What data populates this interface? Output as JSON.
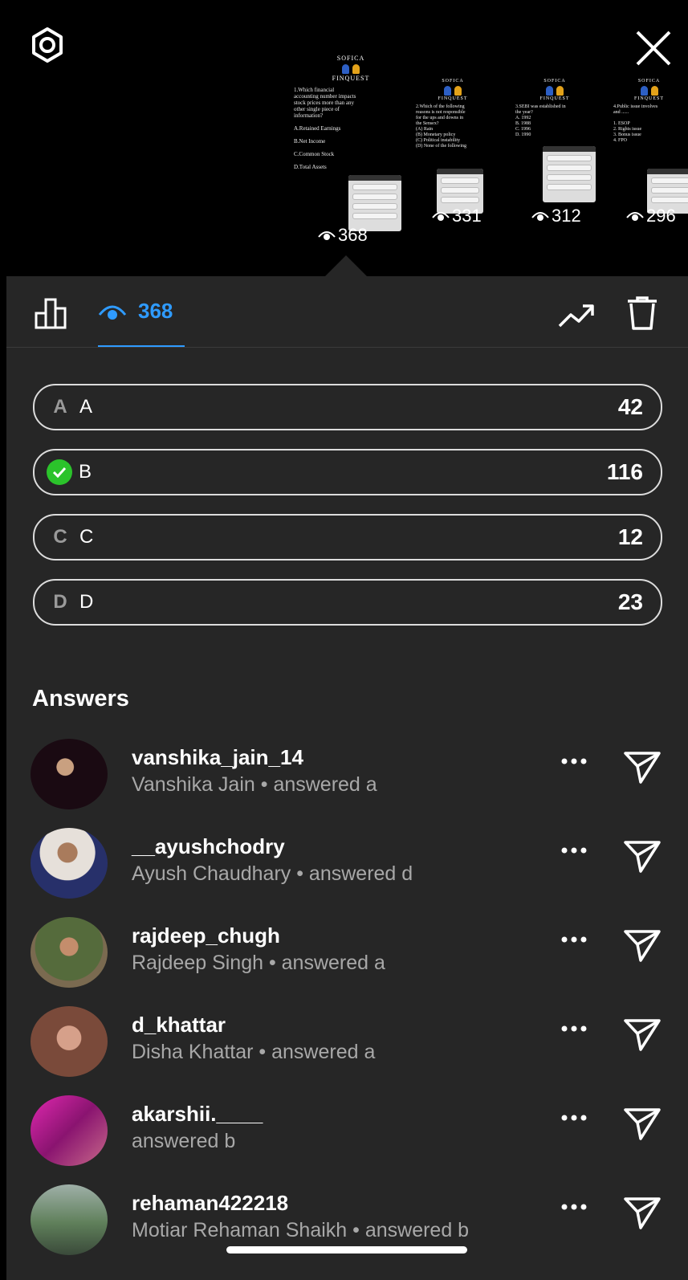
{
  "top": {
    "settings_icon": "gear-icon",
    "close_icon": "close-icon",
    "stories": [
      {
        "brand": "SOFICA",
        "brand2": "FINQUEST",
        "question": "1.Which financial\naccounting number impacts\nstock prices more than any\nother single piece of\ninformation?\n\nA.Retained Earnings\n\nB.Net Income\n\nC.Common Stock\n\nD.Total Assets",
        "views": "368"
      },
      {
        "brand": "SOFICA",
        "brand2": "FINQUEST",
        "question": "2.Which of the following\nreasons is not responsible\nfor the ups and downs in\nthe Sensex?\n(A) Rain\n(B) Monetary policy\n(C) Political instability\n(D) None of the following",
        "views": "331"
      },
      {
        "brand": "SOFICA",
        "brand2": "FINQUEST",
        "question": "3.SEBI was established in\nthe year?\nA. 1992\nB. 1988\nC. 1996\nD. 1990",
        "views": "312"
      },
      {
        "brand": "SOFICA",
        "brand2": "FINQUEST",
        "question": "4.Public issue involves\nand ......\n\n1. ESOP\n2. Rights issue\n3. Bonus issue\n4. FPO",
        "views": "296"
      }
    ]
  },
  "tabs": {
    "stats_icon": "bar-chart-icon",
    "views_count": "368",
    "trend_icon": "trending-icon",
    "delete_icon": "trash-icon"
  },
  "options": [
    {
      "letter": "A",
      "label": "A",
      "count": "42",
      "correct": false
    },
    {
      "letter": "",
      "label": "B",
      "count": "116",
      "correct": true
    },
    {
      "letter": "C",
      "label": "C",
      "count": "12",
      "correct": false
    },
    {
      "letter": "D",
      "label": "D",
      "count": "23",
      "correct": false
    }
  ],
  "answers": {
    "heading": "Answers",
    "rows": [
      {
        "username": "vanshika_jain_14",
        "subtitle": "Vanshika Jain • answered a",
        "avatar_color": "#3a1030"
      },
      {
        "username": "__ayushchodry",
        "subtitle": "Ayush Chaudhary • answered d",
        "avatar_color": "#d8d2cc"
      },
      {
        "username": "rajdeep_chugh",
        "subtitle": "Rajdeep Singh • answered a",
        "avatar_color": "#6b7f4a"
      },
      {
        "username": "d_khattar",
        "subtitle": "Disha Khattar • answered a",
        "avatar_color": "#8a5a4a"
      },
      {
        "username": "akarshii.____",
        "subtitle": "answered b",
        "avatar_color": "#c2188f"
      },
      {
        "username": "rehaman422218",
        "subtitle": "Motiar Rehaman Shaikh • answered b",
        "avatar_color": "#6f8a7a"
      }
    ]
  }
}
